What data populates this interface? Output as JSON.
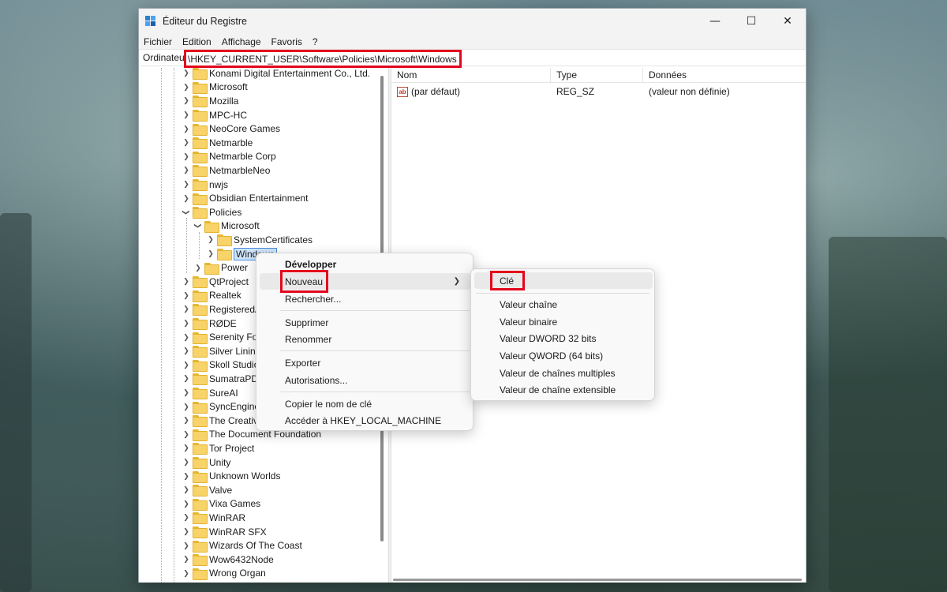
{
  "window": {
    "title": "Éditeur du Registre",
    "controls": {
      "minimize": "—",
      "maximize": "☐",
      "close": "✕"
    }
  },
  "menubar": [
    "Fichier",
    "Edition",
    "Affichage",
    "Favoris",
    "?"
  ],
  "address": {
    "prefix": "Ordinateur",
    "path": "\\HKEY_CURRENT_USER\\Software\\Policies\\Microsoft\\Windows"
  },
  "tree": {
    "items": [
      "Konami Digital Entertainment Co., Ltd.",
      "Microsoft",
      "Mozilla",
      "MPC-HC",
      "NeoCore Games",
      "Netmarble",
      "Netmarble Corp",
      "NetmarbleNeo",
      "nwjs",
      "Obsidian Entertainment",
      "Policies",
      "Microsoft",
      "SystemCertificates",
      "Windows",
      "Power",
      "QtProject",
      "Realtek",
      "RegisteredA",
      "RØDE",
      "Serenity For",
      "Silver Lining",
      "Skoll Studio",
      "SumatraPDF",
      "SureAI",
      "SyncEngine",
      "The Creative",
      "The Document Foundation",
      "Tor Project",
      "Unity",
      "Unknown Worlds",
      "Valve",
      "Vixa Games",
      "WinRAR",
      "WinRAR SFX",
      "Wizards Of The Coast",
      "Wow6432Node",
      "Wrong Organ"
    ],
    "selected": "Windows"
  },
  "list": {
    "columns": [
      "Nom",
      "Type",
      "Données"
    ],
    "rows": [
      {
        "name": "(par défaut)",
        "type": "REG_SZ",
        "data": "(valeur non définie)",
        "icon": "ab-icon"
      }
    ]
  },
  "context_menu": {
    "expand": "Développer",
    "new": "Nouveau",
    "find": "Rechercher...",
    "delete": "Supprimer",
    "rename": "Renommer",
    "export": "Exporter",
    "permissions": "Autorisations...",
    "copy_key_name": "Copier le nom de clé",
    "goto_hklm": "Accéder à HKEY_LOCAL_MACHINE"
  },
  "submenu": {
    "key": "Clé",
    "string_value": "Valeur chaîne",
    "binary_value": "Valeur binaire",
    "dword_value": "Valeur DWORD 32 bits",
    "qword_value": "Valeur QWORD (64 bits)",
    "multi_string": "Valeur de chaînes multiples",
    "expandable_string": "Valeur de chaîne extensible"
  },
  "colors": {
    "highlight_box": "#e3061c",
    "folder": "#f8d369",
    "selection": "#cde4fb"
  }
}
